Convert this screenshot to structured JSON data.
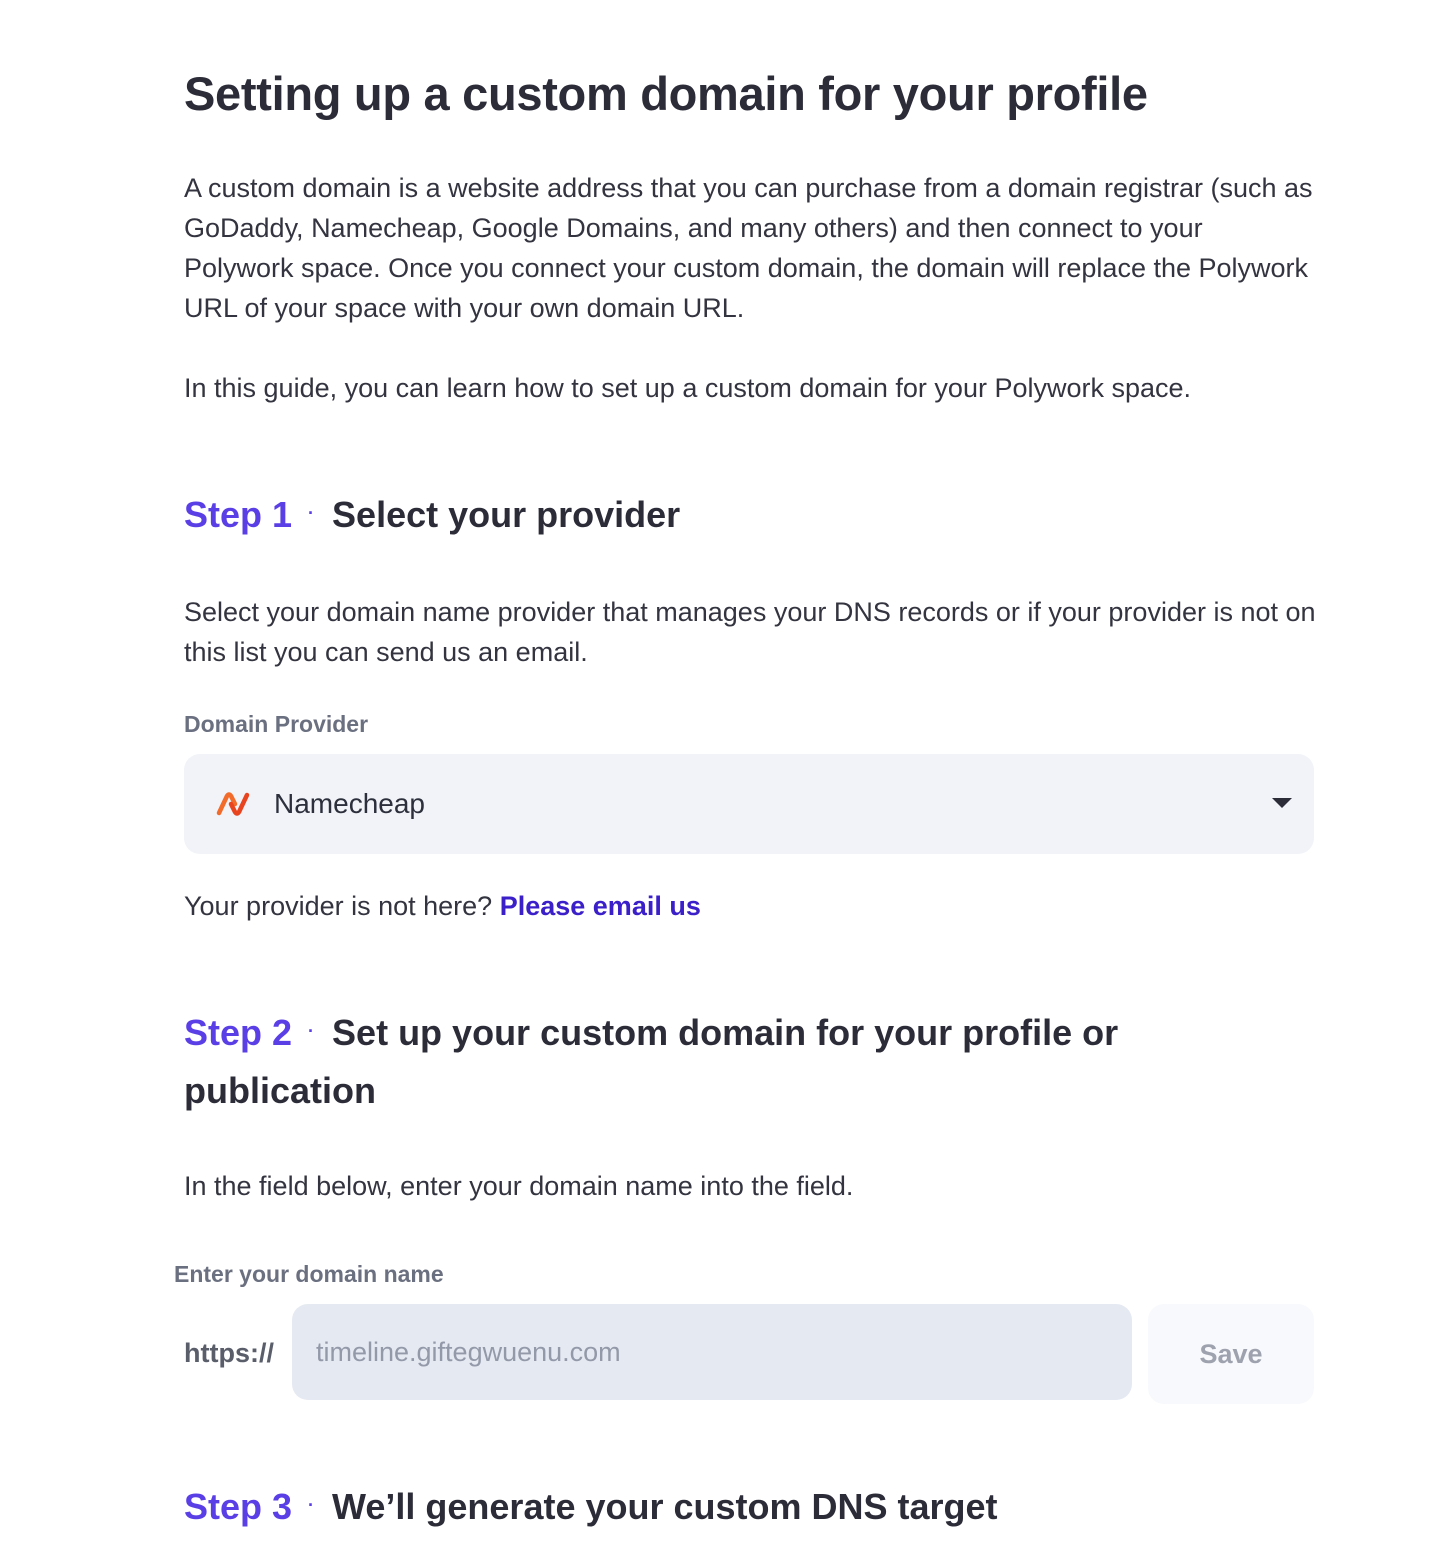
{
  "page": {
    "title": "Setting up a custom domain for your profile",
    "intro": "A custom domain is a website address that you can purchase from a domain registrar (such as GoDaddy, Namecheap, Google Domains, and many others) and then connect to your Polywork space. Once you connect your custom domain, the domain will replace the Polywork URL of your space with your own domain URL.",
    "guide": "In this guide, you can learn how to set up a custom domain for your Polywork space."
  },
  "step1": {
    "number": "Step 1",
    "separator": "·",
    "title": "Select your provider",
    "description": "Select your domain name provider that manages your DNS records or if your provider is not on this list you can send us an email.",
    "field_label": "Domain Provider",
    "selected_provider": "Namecheap",
    "provider_icon": "namecheap-logo-icon",
    "not_here_text": "Your provider is not here?",
    "email_link": "Please email us"
  },
  "step2": {
    "number": "Step 2",
    "separator": "·",
    "title": "Set up your custom domain for your profile or publication",
    "description": "In the field below, enter your domain name into the field.",
    "field_label": "Enter your domain name",
    "prefix": "https://",
    "input_value": "",
    "input_placeholder": "timeline.giftegwuenu.com",
    "save_label": "Save"
  },
  "step3": {
    "number": "Step 3",
    "separator": "·",
    "title": "We’ll generate your custom DNS target"
  },
  "colors": {
    "accent": "#5b3fe6",
    "link": "#3b20c9",
    "heading": "#2b2c38",
    "select_bg": "#f1f3f8",
    "input_bg": "#e5e9f2",
    "logo_orange": "#f26b2a"
  }
}
